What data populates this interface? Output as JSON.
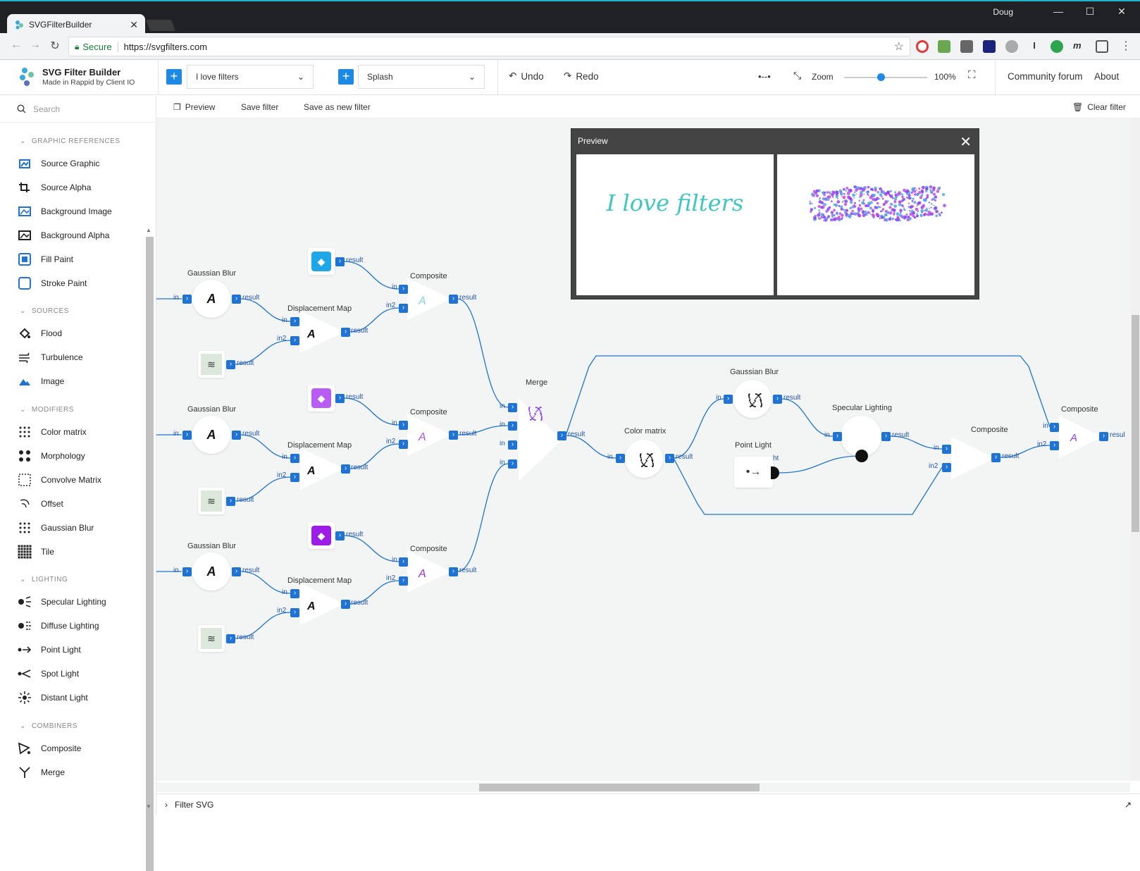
{
  "browser": {
    "tab_title": "SVGFilterBuilder",
    "user": "Doug",
    "secure_label": "Secure",
    "url": "https://svgfilters.com"
  },
  "app": {
    "name": "SVG Filter Builder",
    "subtitle": "Made in Rappid by Client IO",
    "filter_select": "I love filters",
    "preset_select": "Splash",
    "undo": "Undo",
    "redo": "Redo",
    "zoom_label": "Zoom",
    "zoom_value": "100%",
    "zoom_level": 0.45,
    "community": "Community forum",
    "about": "About"
  },
  "subtoolbar": {
    "preview": "Preview",
    "save": "Save filter",
    "save_new": "Save as new filter",
    "clear": "Clear filter"
  },
  "sidebar": {
    "search_placeholder": "Search",
    "sections": [
      {
        "title": "GRAPHIC REFERENCES",
        "items": [
          {
            "label": "Source Graphic",
            "icon": "source-graphic-icon"
          },
          {
            "label": "Source Alpha",
            "icon": "source-alpha-icon"
          },
          {
            "label": "Background Image",
            "icon": "background-image-icon"
          },
          {
            "label": "Background Alpha",
            "icon": "background-alpha-icon"
          },
          {
            "label": "Fill Paint",
            "icon": "fill-paint-icon"
          },
          {
            "label": "Stroke Paint",
            "icon": "stroke-paint-icon"
          }
        ]
      },
      {
        "title": "SOURCES",
        "items": [
          {
            "label": "Flood",
            "icon": "flood-icon"
          },
          {
            "label": "Turbulence",
            "icon": "turbulence-icon"
          },
          {
            "label": "Image",
            "icon": "image-icon"
          }
        ]
      },
      {
        "title": "MODIFIERS",
        "items": [
          {
            "label": "Color matrix",
            "icon": "color-matrix-icon"
          },
          {
            "label": "Morphology",
            "icon": "morphology-icon"
          },
          {
            "label": "Convolve Matrix",
            "icon": "convolve-matrix-icon"
          },
          {
            "label": "Offset",
            "icon": "offset-icon"
          },
          {
            "label": "Gaussian Blur",
            "icon": "gaussian-blur-icon"
          },
          {
            "label": "Tile",
            "icon": "tile-icon"
          }
        ]
      },
      {
        "title": "LIGHTING",
        "items": [
          {
            "label": "Specular Lighting",
            "icon": "specular-lighting-icon"
          },
          {
            "label": "Diffuse Lighting",
            "icon": "diffuse-lighting-icon"
          },
          {
            "label": "Point Light",
            "icon": "point-light-icon"
          },
          {
            "label": "Spot Light",
            "icon": "spot-light-icon"
          },
          {
            "label": "Distant Light",
            "icon": "distant-light-icon"
          }
        ]
      },
      {
        "title": "COMBINERS",
        "items": [
          {
            "label": "Composite",
            "icon": "composite-icon"
          },
          {
            "label": "Merge",
            "icon": "merge-icon"
          }
        ]
      }
    ]
  },
  "graph": {
    "nodes": {
      "gaussian_blur": "Gaussian Blur",
      "displacement_map": "Displacement Map",
      "composite": "Composite",
      "merge": "Merge",
      "color_matrix": "Color matrix",
      "specular_lighting": "Specular Lighting",
      "point_light": "Point Light"
    },
    "ports": {
      "in": "in",
      "in2": "in2",
      "result": "result",
      "light": "ht",
      "result_clipped": "resul"
    },
    "glyph_a": "A",
    "flood_colors": [
      "#1ea7e8",
      "#b95cf4",
      "#9b1de6"
    ]
  },
  "preview": {
    "title": "Preview",
    "close": "✕",
    "source_text": "I love filters",
    "source_color": "#3ec6c0",
    "splash_colors": [
      "#8a3ff0",
      "#4fa3e8",
      "#c048e8"
    ]
  },
  "footer": {
    "label": "Filter SVG"
  }
}
